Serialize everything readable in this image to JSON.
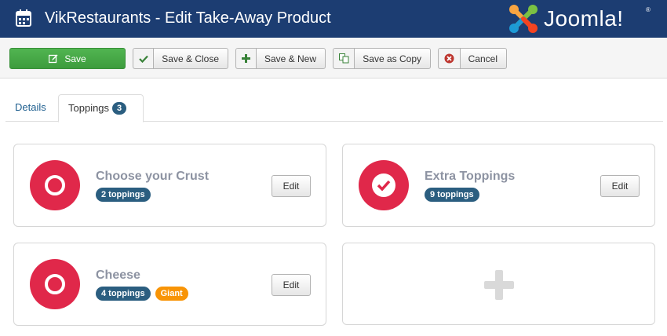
{
  "header": {
    "title": "VikRestaurants - Edit Take-Away Product",
    "logo_text": "Joomla!",
    "logo_reg": "®"
  },
  "toolbar": {
    "save_label": "Save",
    "save_close_label": "Save & Close",
    "save_new_label": "Save & New",
    "save_copy_label": "Save as Copy",
    "cancel_label": "Cancel"
  },
  "tabs": {
    "details_label": "Details",
    "toppings_label": "Toppings",
    "toppings_count": "3"
  },
  "groups": [
    {
      "name": "Choose your Crust",
      "toppings": "2 toppings",
      "icon": "ring-icon",
      "edit_label": "Edit"
    },
    {
      "name": "Extra Toppings",
      "toppings": "9 toppings",
      "icon": "check-icon",
      "edit_label": "Edit"
    },
    {
      "name": "Cheese",
      "toppings": "4 toppings",
      "variation": "Giant",
      "icon": "ring-icon",
      "edit_label": "Edit"
    }
  ],
  "colors": {
    "header_bg": "#1c3d72",
    "save_green": "#46a546",
    "group_red": "#e0284a",
    "badge_blue": "#2b5e80",
    "badge_orange": "#f89406"
  }
}
